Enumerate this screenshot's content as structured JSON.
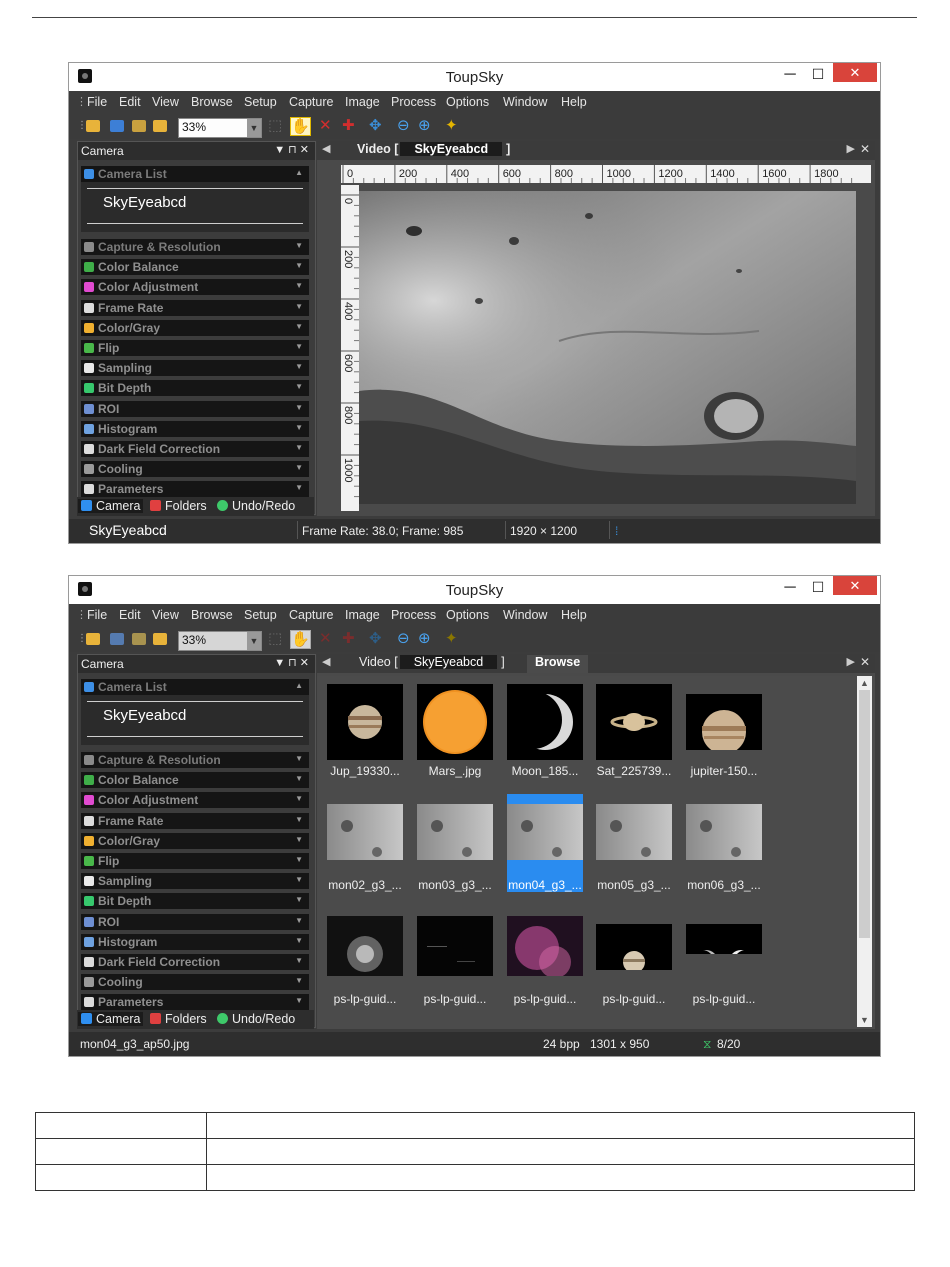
{
  "app": {
    "title": "ToupSky",
    "min_glyph": "─",
    "max_glyph": "☐",
    "close_glyph": "✕",
    "menu": [
      "File",
      "Edit",
      "View",
      "Browse",
      "Setup",
      "Capture",
      "Image",
      "Process",
      "Options",
      "Window",
      "Help"
    ],
    "zoom": "33%",
    "panel_title": "Camera",
    "panel_controls": "▼ ⊓ ✕",
    "camera_list_label": "Camera List",
    "camera_name": "SkyEyeabcd",
    "camera_sections": [
      {
        "label": "Capture & Resolution",
        "icon": "camera-icon",
        "color": "#8a8a8a"
      },
      {
        "label": "Color Balance",
        "icon": "color-balance-icon",
        "color": "#3fae49"
      },
      {
        "label": "Color Adjustment",
        "icon": "color-wheel-icon",
        "color": "#e04ad0"
      },
      {
        "label": "Frame Rate",
        "icon": "clock-icon",
        "color": "#dddddd"
      },
      {
        "label": "Color/Gray",
        "icon": "color-gray-icon",
        "color": "#f0b030"
      },
      {
        "label": "Flip",
        "icon": "flip-icon",
        "color": "#49b84a"
      },
      {
        "label": "Sampling",
        "icon": "sampling-icon",
        "color": "#e9e9e9"
      },
      {
        "label": "Bit Depth",
        "icon": "bit-depth-icon",
        "color": "#37c86d"
      },
      {
        "label": "ROI",
        "icon": "roi-icon",
        "color": "#6e8fd2"
      },
      {
        "label": "Histogram",
        "icon": "histogram-icon",
        "color": "#6fa2e0"
      },
      {
        "label": "Dark Field Correction",
        "icon": "dark-field-icon",
        "color": "#dcdcdc"
      },
      {
        "label": "Cooling",
        "icon": "cooling-icon",
        "color": "#9a9a9a"
      },
      {
        "label": "Parameters",
        "icon": "parameters-icon",
        "color": "#dcdcdc"
      }
    ],
    "bottom_tabs": [
      {
        "label": "Camera",
        "color": "#2f8ff0"
      },
      {
        "label": "Folders",
        "color": "#e04040"
      },
      {
        "label": "Undo/Redo",
        "color": "#3ec96a"
      }
    ]
  },
  "window1": {
    "video_tab_prefix": "Video [",
    "video_tab_camera": "SkyEyeabcd",
    "video_tab_suffix": "]",
    "ruler_top": [
      "0",
      "200",
      "400",
      "600",
      "800",
      "1000",
      "1200",
      "1400",
      "1600",
      "1800"
    ],
    "ruler_left": [
      "0",
      "200",
      "400",
      "600",
      "800",
      "1000"
    ],
    "status": {
      "camera": "SkyEyeabcd",
      "frame": "Frame Rate: 38.0; Frame: 985",
      "resolution": "1920 × 1200"
    }
  },
  "window2": {
    "video_tab_prefix": "Video [",
    "video_tab_camera": "SkyEyeabcd",
    "video_tab_suffix": "]",
    "browse_tab": "Browse",
    "thumbnails": [
      {
        "caption": "Jup_19330...",
        "kind": "jupiter"
      },
      {
        "caption": "Mars_.jpg",
        "kind": "sun"
      },
      {
        "caption": "Moon_185...",
        "kind": "crescent"
      },
      {
        "caption": "Sat_225739...",
        "kind": "saturn"
      },
      {
        "caption": "jupiter-150...",
        "kind": "jupiter2"
      },
      {
        "caption": "mon02_g3_...",
        "kind": "lunar"
      },
      {
        "caption": "mon03_g3_...",
        "kind": "lunar"
      },
      {
        "caption": "mon04_g3_...",
        "kind": "lunar",
        "selected": true
      },
      {
        "caption": "mon05_g3_...",
        "kind": "lunar"
      },
      {
        "caption": "mon06_g3_...",
        "kind": "lunar"
      },
      {
        "caption": "ps-lp-guid...",
        "kind": "cluster"
      },
      {
        "caption": "ps-lp-guid...",
        "kind": "dark"
      },
      {
        "caption": "ps-lp-guid...",
        "kind": "nebula"
      },
      {
        "caption": "ps-lp-guid...",
        "kind": "jupiter3"
      },
      {
        "caption": "ps-lp-guid...",
        "kind": "phases"
      }
    ],
    "status": {
      "file": "mon04_g3_ap50.jpg",
      "bpp": "24 bpp",
      "dims": "1301 x 950",
      "index": "8/20"
    }
  }
}
